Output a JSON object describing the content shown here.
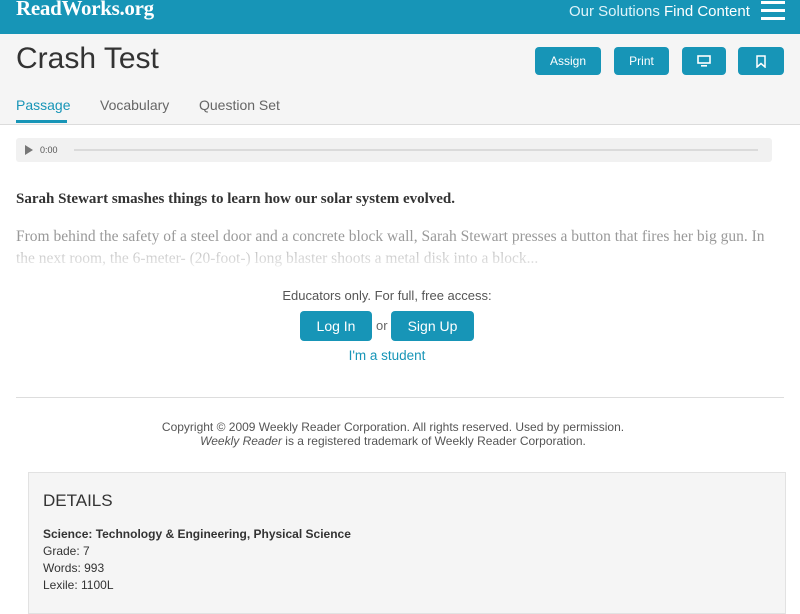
{
  "topbar": {
    "logo": "ReadWorks.org",
    "nav": [
      "Our Solutions",
      "Find Content"
    ],
    "brand_color": "#1795b7"
  },
  "header": {
    "title": "Crash Test",
    "buttons": {
      "assign": "Assign",
      "print": "Print",
      "present_icon": "monitor-icon",
      "bookmark_icon": "bookmark-icon"
    },
    "tabs": [
      "Passage",
      "Vocabulary",
      "Question Set"
    ],
    "active_tab": "Passage"
  },
  "audio": {
    "time": "0:00",
    "progress": 0
  },
  "passage": {
    "lead": "Sarah Stewart smashes things to learn how our solar system evolved.",
    "excerpt": "From behind the safety of a steel door and a concrete block wall, Sarah Stewart presses a button that fires her big gun. In the next room, the 6-meter- (20-foot-) long blaster shoots a metal disk into a block..."
  },
  "access": {
    "text": "Educators only. For full, free access:",
    "login": "Log In",
    "or": "or",
    "signup": "Sign Up",
    "student": "I'm a student"
  },
  "copyright": {
    "line1": "Copyright © 2009 Weekly Reader Corporation. All rights reserved. Used by permission.",
    "line2_em": "Weekly Reader",
    "line2_rest": " is a registered trademark of Weekly Reader Corporation."
  },
  "details": {
    "heading": "DETAILS",
    "subject": "Science: Technology & Engineering, Physical Science",
    "grade": "Grade: 7",
    "words": "Words: 993",
    "lexile": "Lexile: 1100L"
  }
}
